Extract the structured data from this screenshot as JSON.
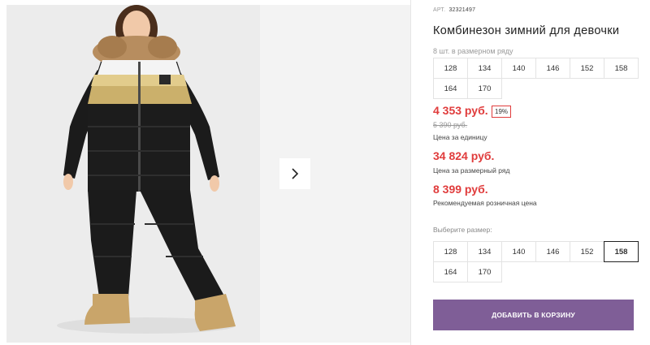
{
  "product": {
    "art_label": "АРТ.",
    "art_value": "32321497",
    "title": "Комбинезон зимний для девочки",
    "range_label": "8 шт. в размерном ряду",
    "range_sizes": [
      "128",
      "134",
      "140",
      "146",
      "152",
      "158",
      "164",
      "170"
    ]
  },
  "pricing": {
    "unit_price": "4 353 руб.",
    "discount": "19%",
    "old_price": "5 390 руб.",
    "unit_note": "Цена за единицу",
    "range_price": "34 824 руб.",
    "range_note": "Цена за размерный ряд",
    "rrp_price": "8 399 руб.",
    "rrp_note": "Рекомендуемая розничная цена"
  },
  "size_picker": {
    "label": "Выберите размер:",
    "sizes": [
      "128",
      "134",
      "140",
      "146",
      "152",
      "158",
      "164",
      "170"
    ],
    "selected": "158"
  },
  "actions": {
    "add_to_cart": "ДОБАВИТЬ В КОРЗИНУ"
  },
  "gallery": {
    "next_icon": "chevron-right-icon"
  },
  "colors": {
    "price_red": "#e03c3c",
    "button_purple": "#7f5e97"
  }
}
